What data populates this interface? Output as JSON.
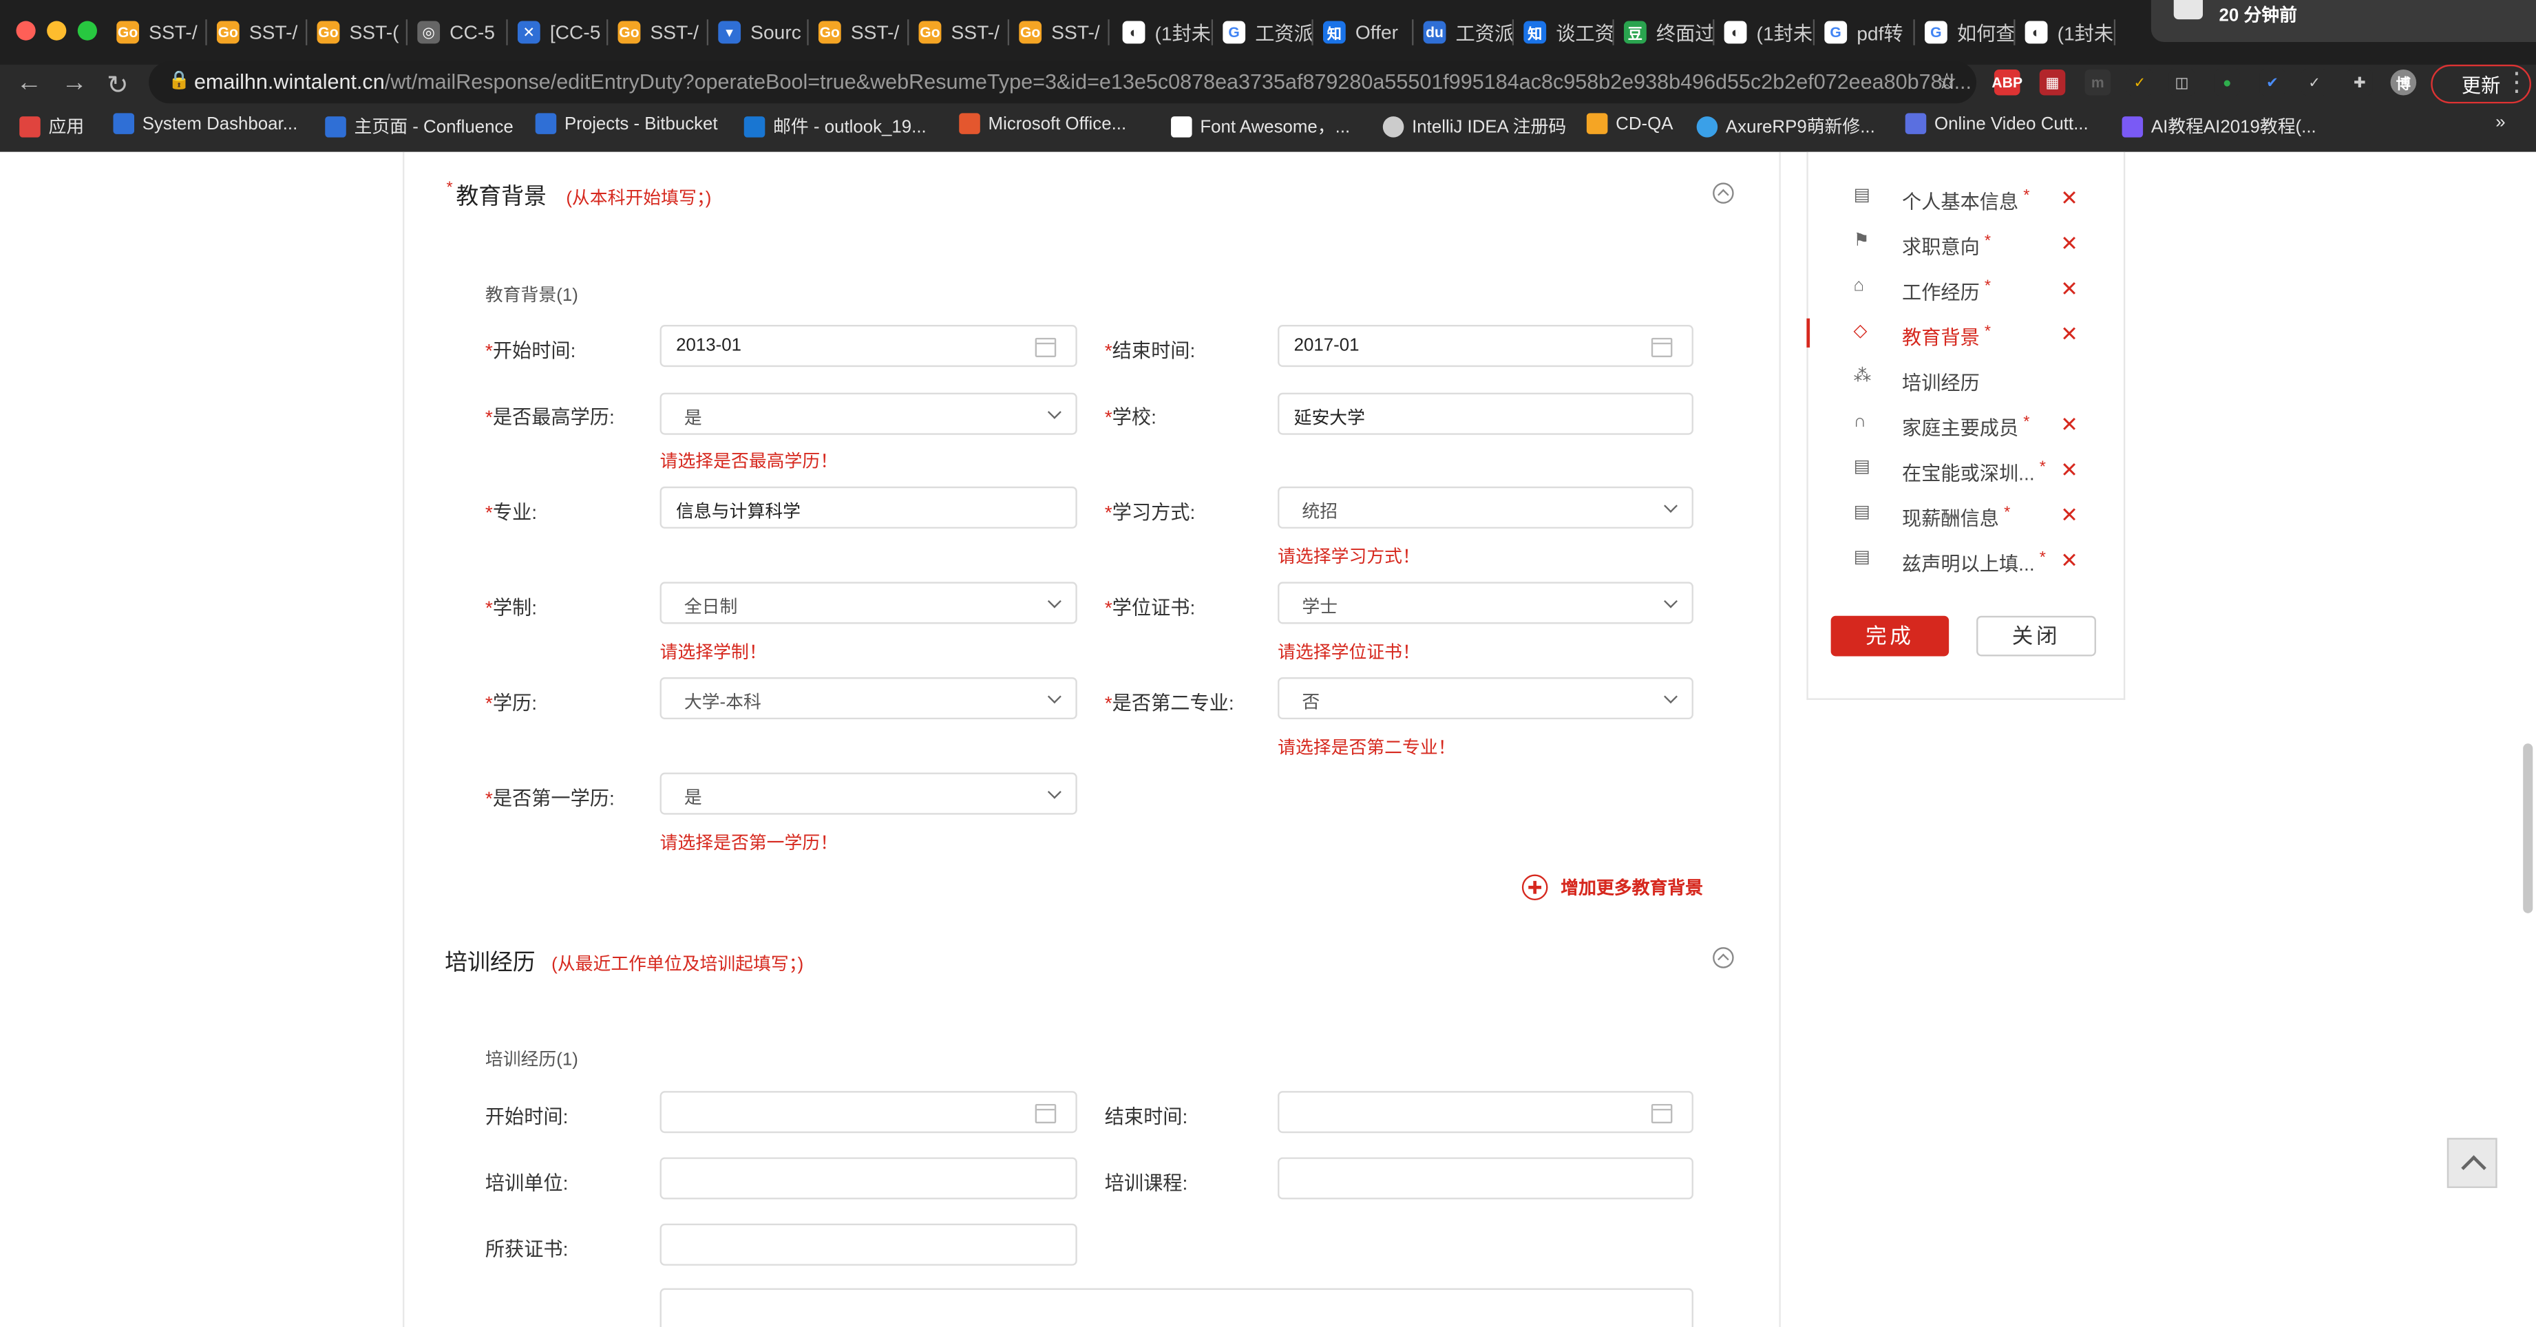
{
  "browser": {
    "tabs": [
      {
        "label": "SST-/",
        "icon": "go-icon"
      },
      {
        "label": "SST-/",
        "icon": "go-icon"
      },
      {
        "label": "SST-(",
        "icon": "go-icon"
      },
      {
        "label": "CC-5",
        "icon": "grey-globe-icon"
      },
      {
        "label": "[CC-5",
        "icon": "jira-icon"
      },
      {
        "label": "SST-/",
        "icon": "go-icon"
      },
      {
        "label": "Sourc",
        "icon": "bitbucket-icon"
      },
      {
        "label": "SST-/",
        "icon": "go-icon"
      },
      {
        "label": "SST-/",
        "icon": "go-icon"
      },
      {
        "label": "SST-/",
        "icon": "go-icon"
      },
      {
        "label": "(1封未",
        "icon": "globe-icon"
      },
      {
        "label": "工资派",
        "icon": "google-icon"
      },
      {
        "label": "Offer",
        "icon": "zhihu-icon"
      },
      {
        "label": "工资派",
        "icon": "baidu-icon"
      },
      {
        "label": "谈工资",
        "icon": "zhihu-icon"
      },
      {
        "label": "终面过",
        "icon": "douban-icon"
      },
      {
        "label": "(1封未",
        "icon": "globe-icon"
      },
      {
        "label": "pdf转",
        "icon": "google-icon"
      },
      {
        "label": "如何查",
        "icon": "google-icon"
      },
      {
        "label": "(1封未",
        "icon": "globe-icon"
      }
    ],
    "notification": "20 分钟前",
    "url_host": "emailhn.wintalent.cn",
    "url_path": "/wt/mailResponse/editEntryDuty?operateBool=true&webResumeType=3&id=e13e5c0878ea3735af879280a55501f995184ac8c958b2e938b496d55c2b2ef072eea80b78d...",
    "update_label": "更新",
    "bookmarks": [
      {
        "label": "应用",
        "color": "#e0443e"
      },
      {
        "label": "System Dashboar...",
        "color": "#2f6fd6"
      },
      {
        "label": "主页面 - Confluence",
        "color": "#2f6fd6"
      },
      {
        "label": "Projects - Bitbucket",
        "color": "#2f6fd6"
      },
      {
        "label": "邮件 - outlook_19...",
        "color": "#1976d2"
      },
      {
        "label": "Microsoft Office...",
        "color": "#e4572e"
      },
      {
        "label": "Font Awesome，...",
        "color": "#ffffff"
      },
      {
        "label": "IntelliJ IDEA 注册码",
        "color": "#cccccc"
      },
      {
        "label": "CD-QA",
        "color": "#f5a524"
      },
      {
        "label": "AxureRP9萌新修...",
        "color": "#3aa0e8"
      },
      {
        "label": "Online Video Cutt...",
        "color": "#5a6fe0"
      },
      {
        "label": "AI教程AI2019教程(...",
        "color": "#7a5af5"
      }
    ]
  },
  "education": {
    "title": "教育背景",
    "hint": "(从本科开始填写；)",
    "subhead": "教育背景(1)",
    "fields": {
      "start_label": "开始时间:",
      "start_value": "2013-01",
      "end_label": "结束时间:",
      "end_value": "2017-01",
      "highest_label": "是否最高学历:",
      "highest_value": "是",
      "highest_error": "请选择是否最高学历！",
      "school_label": "学校:",
      "school_value": "延安大学",
      "major_label": "专业:",
      "major_value": "信息与计算科学",
      "mode_label": "学习方式:",
      "mode_value": "统招",
      "mode_error": "请选择学习方式！",
      "system_label": "学制:",
      "system_value": "全日制",
      "system_error": "请选择学制！",
      "degree_label": "学位证书:",
      "degree_value": "学士",
      "degree_error": "请选择学位证书！",
      "edu_label": "学历:",
      "edu_value": "大学-本科",
      "second_label": "是否第二专业:",
      "second_value": "否",
      "second_error": "请选择是否第二专业！",
      "first_label": "是否第一学历:",
      "first_value": "是",
      "first_error": "请选择是否第一学历！"
    },
    "add_more": "增加更多教育背景"
  },
  "training": {
    "title": "培训经历",
    "hint": "(从最近工作单位及培训起填写；)",
    "subhead": "培训经历(1)",
    "start_label": "开始时间:",
    "end_label": "结束时间:",
    "org_label": "培训单位:",
    "course_label": "培训课程:",
    "cert_label": "所获证书:"
  },
  "sidenav": {
    "items": [
      {
        "label": "个人基本信息",
        "required": "*",
        "icon": "doc-icon"
      },
      {
        "label": "求职意向",
        "required": "*",
        "icon": "flag-icon"
      },
      {
        "label": "工作经历",
        "required": "*",
        "icon": "briefcase-icon"
      },
      {
        "label": "教育背景",
        "required": "*",
        "icon": "graduation-cap-icon"
      },
      {
        "label": "培训经历",
        "required": "",
        "icon": "sitemap-icon"
      },
      {
        "label": "家庭主要成员",
        "required": "*",
        "icon": "headphones-icon"
      },
      {
        "label": "在宝能或深圳...",
        "required": "*",
        "icon": "doc-icon"
      },
      {
        "label": "现薪酬信息",
        "required": "*",
        "icon": "doc-icon"
      },
      {
        "label": "兹声明以上填...",
        "required": "*",
        "icon": "doc-icon"
      }
    ],
    "done_label": "完成",
    "close_label": "关闭"
  },
  "colors": {
    "accent": "#d6281e"
  }
}
